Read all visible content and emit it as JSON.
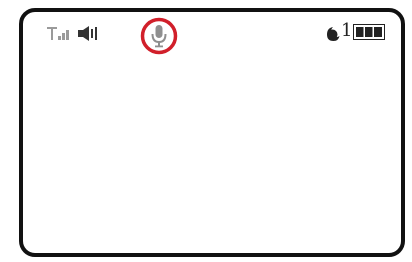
{
  "status_bar": {
    "icons": {
      "signal": "signal-icon",
      "speaker": "speaker-icon",
      "microphone": "microphone-icon",
      "alarm": "moon-icon",
      "battery": "battery-icon"
    },
    "notification_count": "1",
    "battery_level": 1.0
  },
  "colors": {
    "frame": "#111111",
    "highlight": "#d11f2a",
    "icon_dark": "#222222",
    "icon_grey": "#9a9a9a"
  }
}
